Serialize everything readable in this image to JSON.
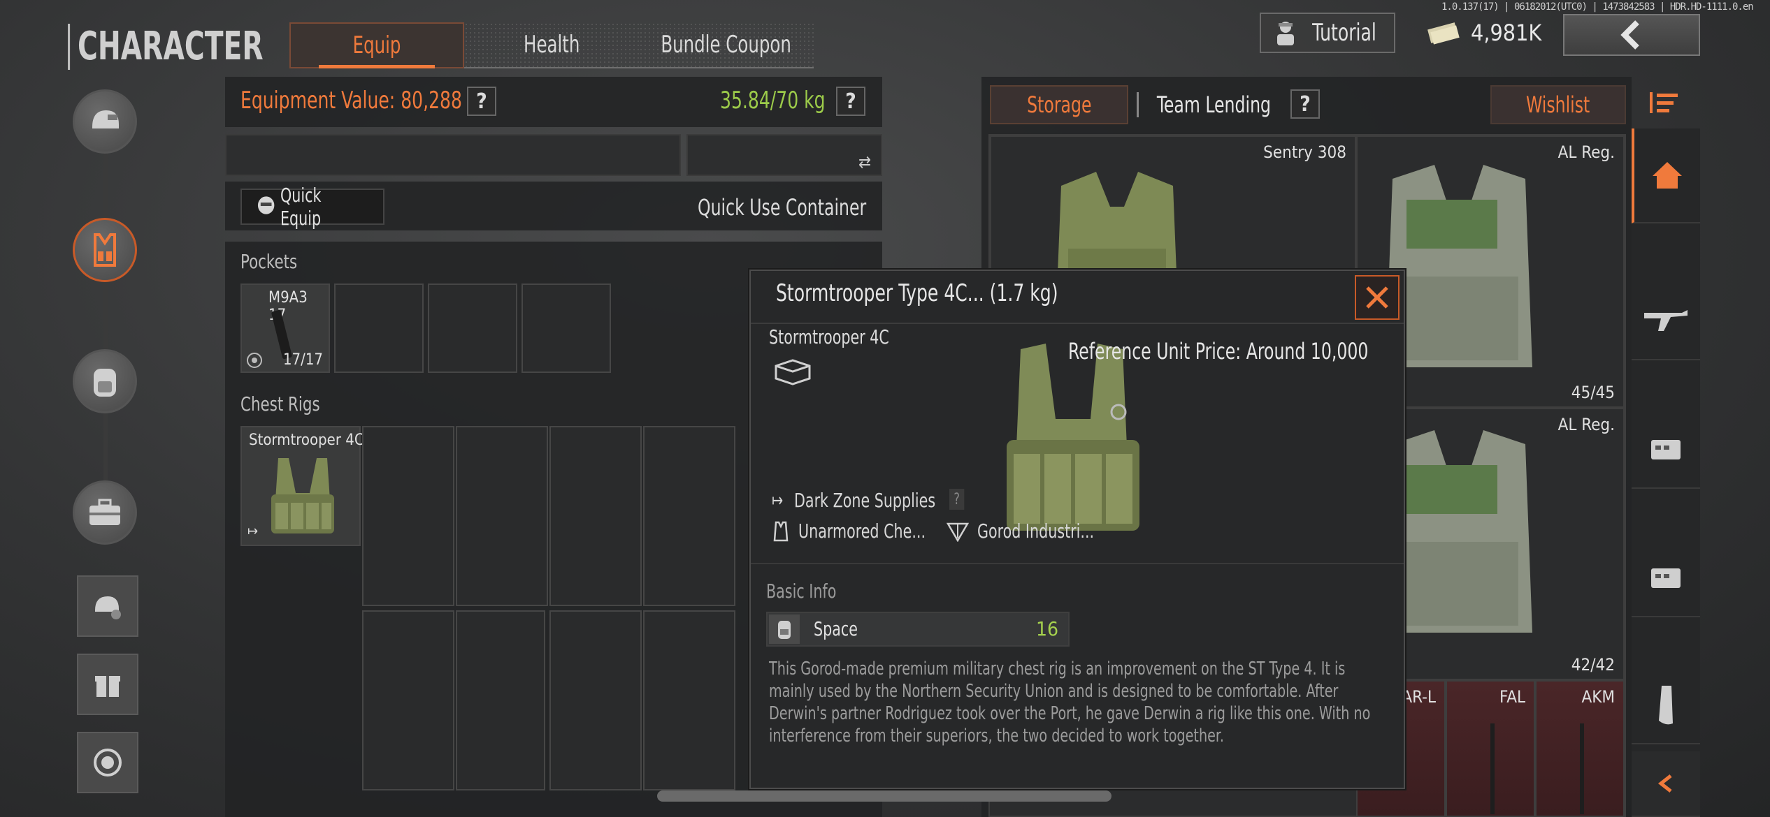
{
  "app": {
    "title": "CHARACTER",
    "version": "1.0.137(17) | 06182012(UTC0) | 1473842583 | HDR.HD-1111.0.en"
  },
  "tabs": [
    {
      "label": "Equip",
      "active": true
    },
    {
      "label": "Health",
      "active": false
    },
    {
      "label": "Bundle Coupon",
      "active": false
    }
  ],
  "topbar": {
    "tutorial_label": "Tutorial",
    "money": "4,981K"
  },
  "equipment": {
    "value_label": "Equipment Value: 80,288",
    "help": "?",
    "weight": "35.84/70 kg",
    "quick_equip_label": "Quick Equip",
    "quick_use_label": "Quick Use Container"
  },
  "pockets": {
    "label": "Pockets",
    "items": [
      {
        "name": "M9A3 17",
        "count": "17/17"
      },
      {
        "name": "",
        "count": ""
      },
      {
        "name": "",
        "count": ""
      },
      {
        "name": "",
        "count": ""
      }
    ]
  },
  "chest_rigs": {
    "label": "Chest Rigs",
    "item_name": "Stormtrooper 4C"
  },
  "storage": {
    "tabs": [
      "Storage",
      "Team Lending"
    ],
    "help": "?",
    "wishlist_label": "Wishlist",
    "items": [
      {
        "name": "Sentry 308",
        "count": ""
      },
      {
        "name": "AL Reg.",
        "count": "45/45"
      },
      {
        "name": "AL Reg.",
        "count": "42/42"
      },
      {
        "name": "CAR-L",
        "count": ""
      },
      {
        "name": "FAL",
        "count": ""
      },
      {
        "name": "AKM",
        "count": ""
      }
    ]
  },
  "popup": {
    "title": "Stormtrooper Type 4C... (1.7 kg)",
    "item_name": "Stormtrooper 4C",
    "reference_price": "Reference Unit Price: Around 10,000",
    "source": "Dark Zone Supplies",
    "source_help": "?",
    "type": "Unarmored Che...",
    "maker": "Gorod Industri...",
    "basic_info_label": "Basic Info",
    "space_label": "Space",
    "space_value": "16",
    "description": "This Gorod-made premium military chest rig is an improvement on the ST Type 4. It is mainly used by the Northern Security Union and is designed to be comfortable. After Derwin's partner Rodriguez took over the Port, he gave Derwin a rig like this one. With no interference from their superiors, the two decided to work together."
  },
  "icons": {
    "accent": "#f07a3c",
    "weight_color": "#9ccb4a",
    "space_color": "#a6d24e"
  }
}
